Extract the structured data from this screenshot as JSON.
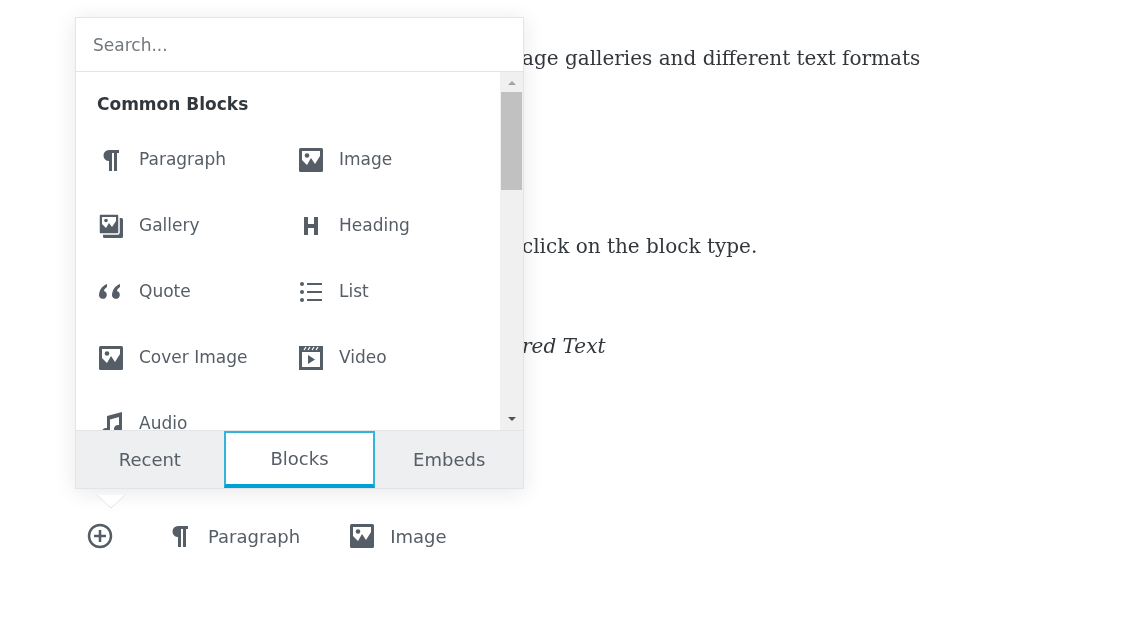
{
  "background_text": [
    {
      "text": "age galleries and different text formats",
      "italic": false
    },
    {
      "text": "click on the block type.",
      "italic": false
    },
    {
      "text": "red Text",
      "italic": true
    }
  ],
  "inserter": {
    "search": {
      "placeholder": "Search..."
    },
    "section_title": "Common Blocks",
    "blocks": [
      {
        "label": "Paragraph",
        "kind": "paragraph"
      },
      {
        "label": "Image",
        "kind": "image"
      },
      {
        "label": "Gallery",
        "kind": "gallery"
      },
      {
        "label": "Heading",
        "kind": "heading"
      },
      {
        "label": "Quote",
        "kind": "quote"
      },
      {
        "label": "List",
        "kind": "list"
      },
      {
        "label": "Cover Image",
        "kind": "image"
      },
      {
        "label": "Video",
        "kind": "video"
      },
      {
        "label": "Audio",
        "kind": "audio"
      }
    ],
    "tabs": [
      {
        "label": "Recent",
        "selected": false
      },
      {
        "label": "Blocks",
        "selected": true
      },
      {
        "label": "Embeds",
        "selected": false
      }
    ]
  },
  "toolbar": [
    {
      "kind": "inserter"
    },
    {
      "kind": "paragraph",
      "label": "Paragraph"
    },
    {
      "kind": "image",
      "label": "Image"
    }
  ]
}
